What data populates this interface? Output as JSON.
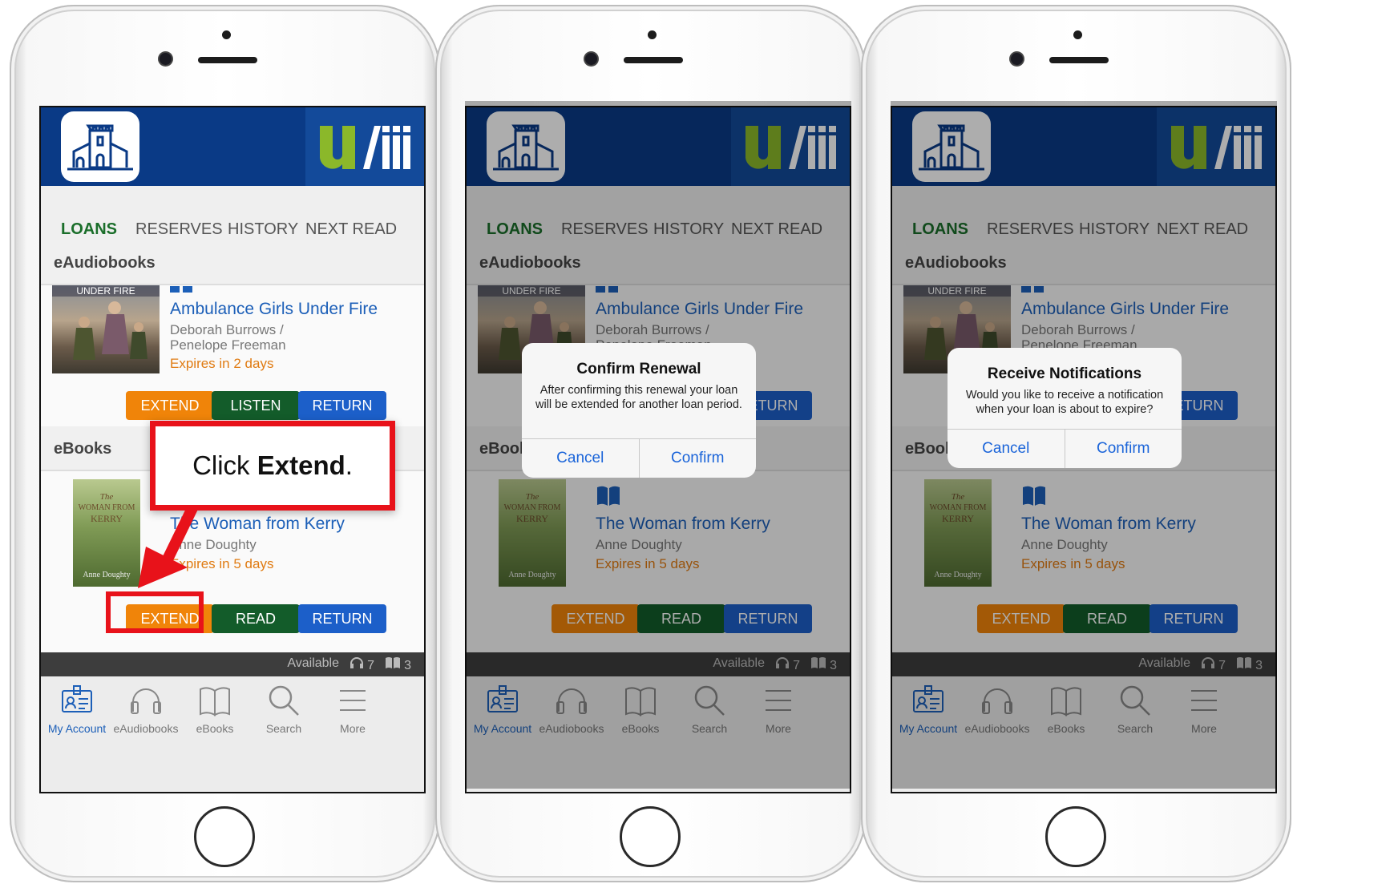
{
  "tabs": [
    "LOANS",
    "RESERVES",
    "HISTORY",
    "NEXT READ"
  ],
  "sections": {
    "audio": "eAudiobooks",
    "ebooks": "eBooks"
  },
  "audiobook": {
    "cover_text": "UNDER FIRE",
    "title": "Ambulance Girls Under Fire",
    "author_line1": "Deborah Burrows /",
    "author_line2": "Penelope Freeman",
    "expiry": "Expires in 2 days",
    "buttons": [
      "EXTEND",
      "LISTEN",
      "RETURN"
    ]
  },
  "ebook": {
    "cover_title_1": "The",
    "cover_title_2": "WOMAN FROM",
    "cover_title_3": "KERRY",
    "cover_author": "Anne Doughty",
    "title": "The Woman from Kerry",
    "author": "Anne Doughty",
    "expiry": "Expires in 5 days",
    "buttons": [
      "EXTEND",
      "READ",
      "RETURN"
    ]
  },
  "availability": {
    "label": "Available",
    "audio_count": "7",
    "ebook_count": "3"
  },
  "tabbar": [
    "My Account",
    "eAudiobooks",
    "eBooks",
    "Search",
    "More"
  ],
  "callout": {
    "prefix": "Click ",
    "bold": "Extend",
    "suffix": "."
  },
  "dialog_renewal": {
    "title": "Confirm Renewal",
    "message": "After confirming this renewal your loan will be extended for another loan period.",
    "cancel": "Cancel",
    "confirm": "Confirm"
  },
  "dialog_notify": {
    "title": "Receive Notifications",
    "message": "Would you like to receive a notification when your loan is about to expire?",
    "cancel": "Cancel",
    "confirm": "Confirm"
  },
  "colors": {
    "header": "#0a3a86",
    "green": "#135c2a",
    "orange": "#f08409",
    "blue": "#1c5fc9",
    "callout_red": "#e8121a"
  }
}
